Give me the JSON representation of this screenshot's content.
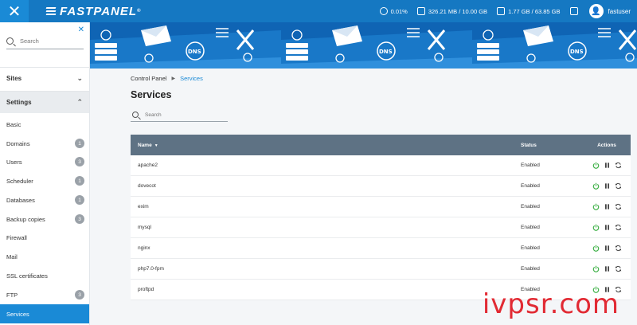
{
  "topbar": {
    "logo_text": "FASTPANEL",
    "logo_reg": "®",
    "close_icon": "close-icon",
    "stats": [
      {
        "icon": "cpu-icon",
        "value": "0.01%"
      },
      {
        "icon": "memory-icon",
        "value": "326.21 MB / 10.00 GB"
      },
      {
        "icon": "disk-icon",
        "value": "1.77 GB / 63.85 GB"
      }
    ],
    "server_icon": "server-icon",
    "username": "fastuser"
  },
  "sidebar": {
    "search_placeholder": "Search",
    "groups": [
      {
        "label": "Sites",
        "expanded": false
      },
      {
        "label": "Settings",
        "expanded": true
      }
    ],
    "items": [
      {
        "label": "Basic",
        "badge": ""
      },
      {
        "label": "Domains",
        "badge": "1"
      },
      {
        "label": "Users",
        "badge": "3"
      },
      {
        "label": "Scheduler",
        "badge": "1"
      },
      {
        "label": "Databases",
        "badge": "1"
      },
      {
        "label": "Backup copies",
        "badge": "3"
      },
      {
        "label": "Firewall",
        "badge": ""
      },
      {
        "label": "Mail",
        "badge": ""
      },
      {
        "label": "SSL certificates",
        "badge": ""
      },
      {
        "label": "FTP",
        "badge": "3"
      },
      {
        "label": "Services",
        "badge": "",
        "active": true
      }
    ]
  },
  "breadcrumb": {
    "root": "Control Panel",
    "current": "Services"
  },
  "page": {
    "title": "Services",
    "search_placeholder": "Search"
  },
  "table": {
    "headers": {
      "name": "Name",
      "status": "Status",
      "actions": "Actions"
    },
    "rows": [
      {
        "name": "apache2",
        "status": "Enabled"
      },
      {
        "name": "dovecot",
        "status": "Enabled"
      },
      {
        "name": "exim",
        "status": "Enabled"
      },
      {
        "name": "mysql",
        "status": "Enabled"
      },
      {
        "name": "nginx",
        "status": "Enabled"
      },
      {
        "name": "php7.0-fpm",
        "status": "Enabled"
      },
      {
        "name": "proftpd",
        "status": "Enabled"
      }
    ]
  },
  "watermark": "ivpsr.com",
  "colors": {
    "topbar": "#1578c2",
    "accent": "#1a8ad6",
    "table_header": "#5e7284",
    "power_icon": "#3cb045",
    "watermark": "#e0141e"
  }
}
